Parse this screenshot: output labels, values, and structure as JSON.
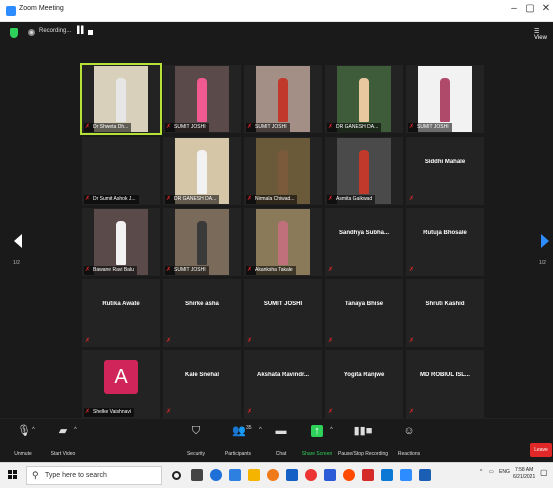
{
  "window": {
    "title": "Zoom Meeting",
    "minimize": "–",
    "maximize": "▢",
    "close": "✕"
  },
  "topbar": {
    "recording_label": "Recording...",
    "view_label": "View"
  },
  "pager": {
    "left_page": "1/2",
    "right_page": "1/2"
  },
  "participants": [
    {
      "label": "Dr Shweta Dh...",
      "type": "video",
      "active": true
    },
    {
      "label": "SUMIT JOSHI",
      "type": "video"
    },
    {
      "label": "SUMIT JOSHI",
      "type": "video"
    },
    {
      "label": "DR GANESH DA...",
      "type": "video"
    },
    {
      "label": "SUMIT JOSHI",
      "type": "video"
    },
    {
      "label": "Dr Sumit Ashok J...",
      "type": "blank"
    },
    {
      "label": "DR GANESH DA...",
      "type": "video"
    },
    {
      "label": "Nirmala Chiwad...",
      "type": "video"
    },
    {
      "label": "Asmita Gaikwad",
      "type": "video"
    },
    {
      "name": "Siddhi Mahale",
      "type": "name"
    },
    {
      "label": "Bawane Ravi Balu",
      "type": "video"
    },
    {
      "label": "SUMIT JOSHI",
      "type": "video"
    },
    {
      "label": "Akanksha Takale",
      "type": "video"
    },
    {
      "name": "Sandhya  Subha...",
      "type": "name"
    },
    {
      "name": "Rutuja Bhosale",
      "type": "name"
    },
    {
      "name": "Rutika Awate",
      "type": "name"
    },
    {
      "name": "Shirke asha",
      "type": "name"
    },
    {
      "name": "SUMIT JOSHI",
      "type": "name"
    },
    {
      "name": "Tanaya Bhise",
      "type": "name"
    },
    {
      "name": "Shruti Kashid",
      "type": "name"
    },
    {
      "label": "Shelke Vaishnavi",
      "type": "avatar",
      "avatar_letter": "A"
    },
    {
      "name": "Kale Snehal",
      "type": "name"
    },
    {
      "name": "Akshata  Ravindr...",
      "type": "name"
    },
    {
      "name": "Yogita Ranjwe",
      "type": "name"
    },
    {
      "name": "MD ROBIUL ISL...",
      "type": "name"
    }
  ],
  "toolbar": {
    "unmute": "Unmute",
    "start_video": "Start Video",
    "security": "Security",
    "participants": "Participants",
    "participants_count": "35",
    "chat": "Chat",
    "share_screen": "Share Screen",
    "pause_recording": "Pause/Stop Recording",
    "reactions": "Reactions",
    "leave": "Leave"
  },
  "taskbar": {
    "search_placeholder": "Type here to search",
    "language": "ENG",
    "time": "7:58 AM",
    "date": "6/21/2021"
  },
  "colors": {
    "active_speaker": "#b6e238",
    "leave": "#e02828",
    "share": "#2ed15a",
    "zoom_blue": "#2d8cff",
    "avatar": "#d0255b"
  }
}
